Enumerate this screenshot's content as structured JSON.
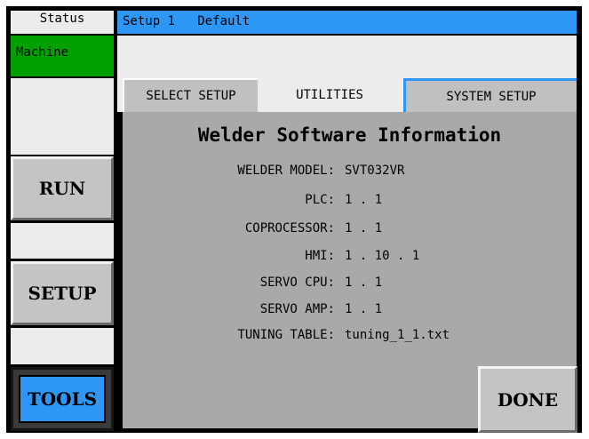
{
  "status": {
    "label": "Status",
    "machine": "Machine"
  },
  "header": {
    "setup_text": "Setup 1   Default"
  },
  "tabs": [
    {
      "label": "SELECT SETUP"
    },
    {
      "label": "UTILITIES"
    },
    {
      "label": "SYSTEM SETUP"
    }
  ],
  "active_tab": "SYSTEM SETUP",
  "panel": {
    "title": "Welder Software Information",
    "rows": [
      {
        "label": "WELDER MODEL:",
        "value": "SVT032VR"
      },
      {
        "label": "PLC:",
        "value": "1 . 1"
      },
      {
        "label": "COPROCESSOR:",
        "value": "1 . 1"
      },
      {
        "label": "HMI:",
        "value": "1 . 10 . 1"
      },
      {
        "label": "SERVO CPU:",
        "value": "1 . 1"
      },
      {
        "label": "SERVO AMP:",
        "value": "1 . 1"
      },
      {
        "label": "TUNING TABLE:",
        "value": "tuning_1_1.txt"
      }
    ]
  },
  "buttons": {
    "run": "RUN",
    "setup": "SETUP",
    "tools": "TOOLS",
    "done": "DONE"
  },
  "colors": {
    "accent_blue": "#2e97f5",
    "machine_green": "#00a000",
    "panel_gray": "#a9a9a9"
  }
}
